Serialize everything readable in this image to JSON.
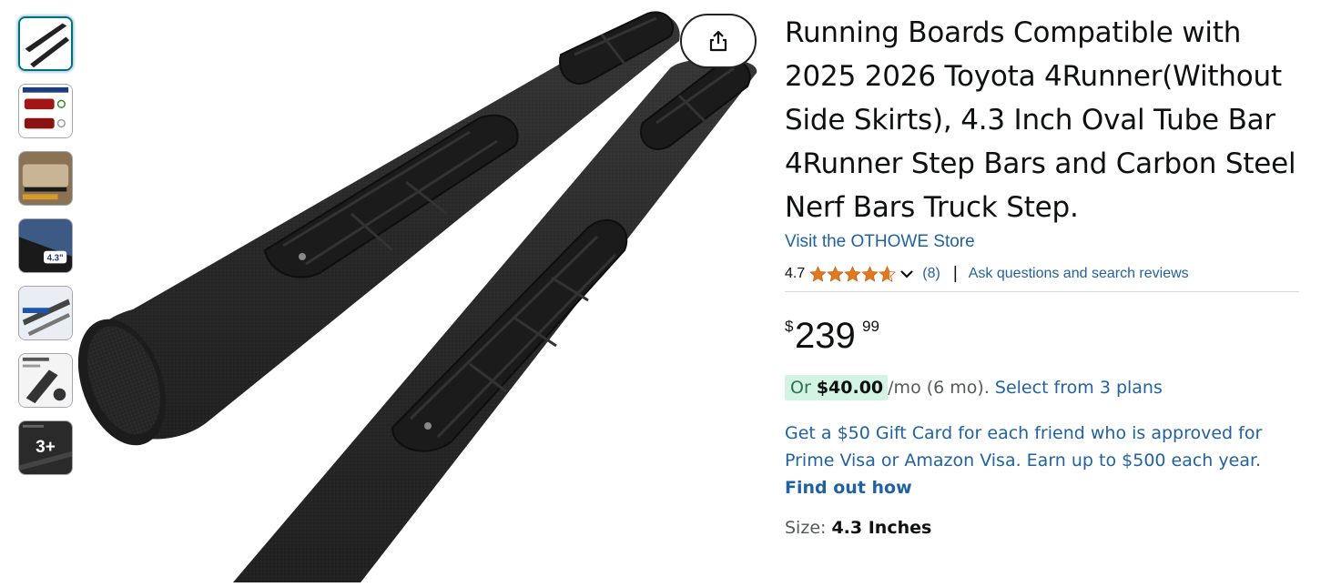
{
  "product": {
    "title": "Running Boards Compatible with 2025 2026 Toyota 4Runner(Without Side Skirts), 4.3 Inch Oval Tube Bar 4Runner Step Bars and Carbon Steel Nerf Bars Truck Step.",
    "store_link": "Visit the OTHOWE Store",
    "rating": {
      "value": "4.7",
      "stars": 4.7,
      "count": "(8)",
      "separator": "|",
      "ask_link": "Ask questions and search reviews"
    },
    "price": {
      "symbol": "$",
      "whole": "239",
      "fraction": "99"
    },
    "installment": {
      "prefix": "Or",
      "amount": "$40.00",
      "terms": "/mo (6 mo).",
      "link": "Select from 3 plans"
    },
    "promo": {
      "text": "Get a $50 Gift Card for each friend who is approved for Prime Visa or Amazon Visa. Earn up to $500 each year.",
      "cta": "Find out how"
    },
    "size": {
      "label": "Size:",
      "value": "4.3 Inches"
    }
  },
  "gallery": {
    "selected_index": 0,
    "more_label": "3+",
    "icons": {
      "share": "share-icon",
      "stars": "star-icon",
      "expand": "chevron-down-icon"
    }
  },
  "colors": {
    "link": "#2162a1",
    "star": "#de7921",
    "selected_thumb": "#007185",
    "installment_bg": "#d3f4e3"
  }
}
